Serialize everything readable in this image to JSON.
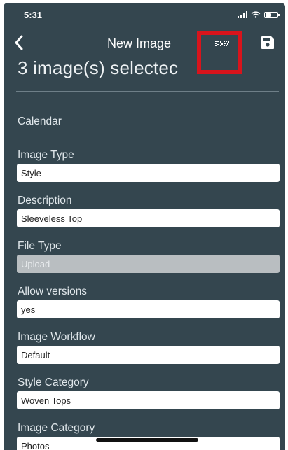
{
  "status_bar": {
    "time": "5:31"
  },
  "nav": {
    "title": "New Image"
  },
  "header": {
    "selected_text": "3 image(s) selectec"
  },
  "form": {
    "calendar_label": "Calendar",
    "fields": [
      {
        "label": "Image Type",
        "value": "Style"
      },
      {
        "label": "Description",
        "value": "Sleeveless Top"
      },
      {
        "label": "File Type",
        "value": "Upload"
      },
      {
        "label": "Allow versions",
        "value": "yes"
      },
      {
        "label": "Image Workflow",
        "value": "Default"
      },
      {
        "label": "Style Category",
        "value": "Woven Tops"
      },
      {
        "label": "Image Category",
        "value": "Photos"
      }
    ]
  },
  "colors": {
    "background": "#34464f",
    "highlight": "#d8141c",
    "disabled_field": "#b9bec1"
  },
  "icons": [
    "chevron-left-icon",
    "qr-code-icon",
    "save-icon",
    "signal-icon",
    "wifi-icon",
    "battery-icon"
  ]
}
